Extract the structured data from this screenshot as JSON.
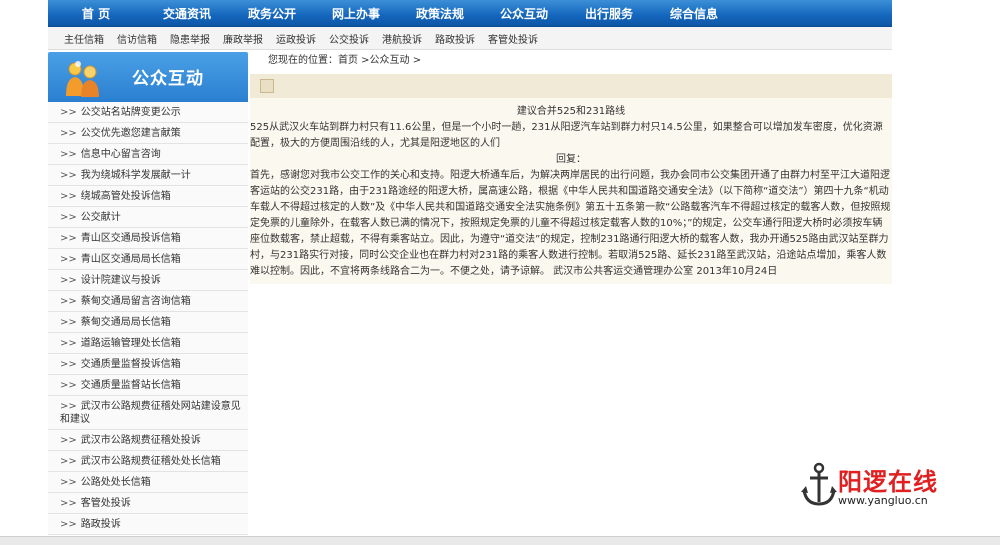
{
  "top_nav": [
    "首 页",
    "交通资讯",
    "政务公开",
    "网上办事",
    "政策法规",
    "公众互动",
    "出行服务",
    "综合信息"
  ],
  "sub_nav": [
    "主任信箱",
    "信访信箱",
    "隐患举报",
    "廉政举报",
    "运政投诉",
    "公交投诉",
    "港航投诉",
    "路政投诉",
    "客管处投诉"
  ],
  "sidebar": {
    "title": "公众互动",
    "arrow": ">>",
    "items": [
      "公交站名站牌变更公示",
      "公交优先邀您建言献策",
      "信息中心留言咨询",
      "我为绕城科学发展献一计",
      "绕城高管处投诉信箱",
      "公交献计",
      "青山区交通局投诉信箱",
      "青山区交通局局长信箱",
      "设计院建议与投诉",
      "蔡甸交通局留言咨询信箱",
      "蔡甸交通局局长信箱",
      "道路运输管理处长信箱",
      "交通质量监督投诉信箱",
      "交通质量监督站长信箱",
      "武汉市公路规费征稽处网站建设意见和建议",
      "武汉市公路规费征稽处投诉",
      "武汉市公路规费征稽处处长信箱",
      "公路处处长信箱",
      "客管处投诉",
      "路政投诉"
    ]
  },
  "breadcrumb": "您现在的位置：首页 >公众互动 >",
  "article": {
    "title": "建议合并525和231路线",
    "question": "525从武汉火车站到群力村只有11.6公里，但是一个小时一趟，231从阳逻汽车站到群力村只14.5公里，如果整合可以增加发车密度，优化资源配置，极大的方便周围沿线的人，尤其是阳逻地区的人们",
    "reply_label": "回复：",
    "reply": "首先，感谢您对我市公交工作的关心和支持。阳逻大桥通车后，为解决两岸居民的出行问题，我办会同市公交集团开通了由群力村至平江大道阳逻客运站的公交231路，由于231路途经的阳逻大桥，属高速公路，根据《中华人民共和国道路交通安全法》（以下简称“道交法”）第四十九条“机动车载人不得超过核定的人数”及《中华人民共和国道路交通安全法实施条例》第五十五条第一款“公路载客汽车不得超过核定的载客人数，但按照规定免票的儿童除外，在载客人数已满的情况下，按照规定免票的儿童不得超过核定载客人数的10%；”的规定，公交车通行阳逻大桥时必须按车辆座位数载客，禁止超载，不得有乘客站立。因此，为遵守“道交法”的规定，控制231路通行阳逻大桥的载客人数，我办开通525路由武汉站至群力村，与231路实行对接，同时公交企业也在群力村对231路的乘客人数进行控制。若取消525路、延长231路至武汉站，沿途站点增加，乘客人数难以控制。因此，不宜将两条线路合二为一。不便之处，请予谅解。  武汉市公共客运交通管理办公室 2013年10月24日"
  },
  "logo": {
    "name": "阳逻在线",
    "url": "www.yangluo.cn"
  },
  "colors": {
    "nav_blue": "#1366bd",
    "sidebar_blue": "#2b7fd0",
    "logo_red": "#e02020",
    "banner_tan": "#f1ead6"
  }
}
